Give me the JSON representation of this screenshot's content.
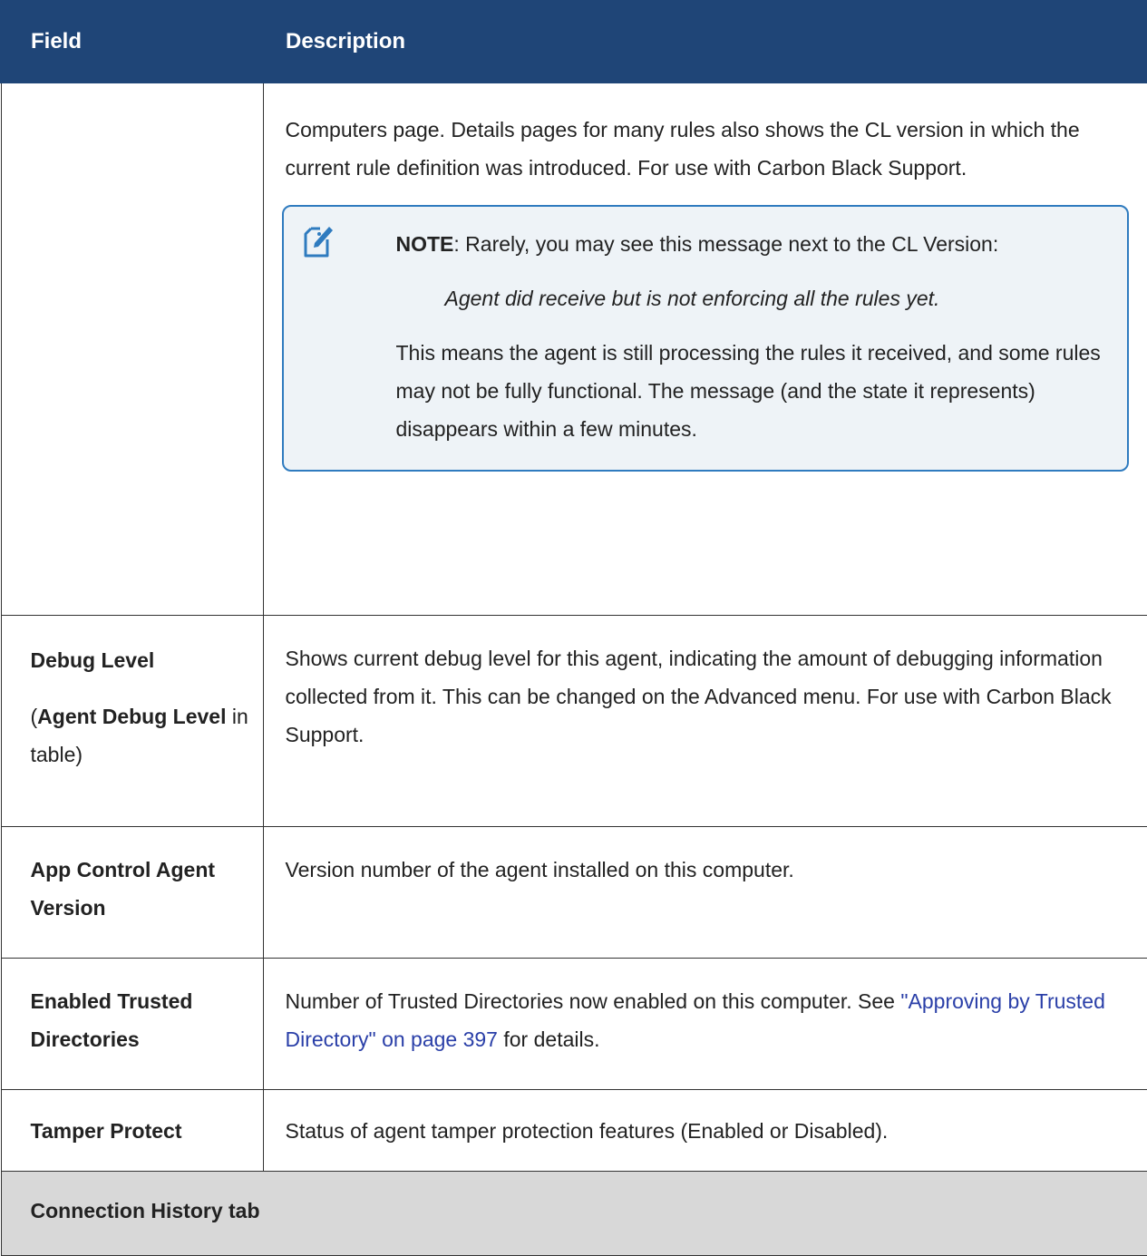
{
  "header": {
    "field": "Field",
    "description": "Description"
  },
  "rows": [
    {
      "field": "",
      "description": "Computers page. Details pages for many rules also shows the CL version in which the current rule definition was introduced. For use with Carbon Black Support.",
      "note": {
        "label": "NOTE",
        "text": ": Rarely, you may see this message next to the CL Version:",
        "quote": "Agent did receive but is not enforcing all the rules yet.",
        "followup": "This means the agent is still processing the rules it received, and some rules may not be fully functional. The message (and the state it represents) disappears within a few minutes."
      }
    },
    {
      "field_bold": "Debug Level",
      "field_paren_open": "(",
      "field_bold2": "Agent Debug Level",
      "field_plain": " in table)",
      "description": "Shows current debug level for this agent, indicating the amount of debugging information collected from it. This can be changed on the Advanced menu. For use with Carbon Black Support."
    },
    {
      "field": "App Control Agent Version",
      "description": "Version number of the agent installed on this computer."
    },
    {
      "field": "Enabled Trusted Directories",
      "description_pre": "Number of Trusted Directories now enabled on this computer. See ",
      "link": "\"Approving by Trusted Directory\" on page 397",
      "description_post": " for details."
    },
    {
      "field": "Tamper Protect",
      "description": "Status of agent tamper protection features (Enabled or Disabled)."
    }
  ],
  "section": {
    "title": "Connection History tab"
  },
  "icons": {
    "note": "note-pencil-icon"
  },
  "colors": {
    "header_bg": "#1f4577",
    "note_border": "#2f7bbf",
    "note_bg": "#eef3f7",
    "section_bg": "#d8d8d8",
    "link": "#2a3fa8"
  }
}
